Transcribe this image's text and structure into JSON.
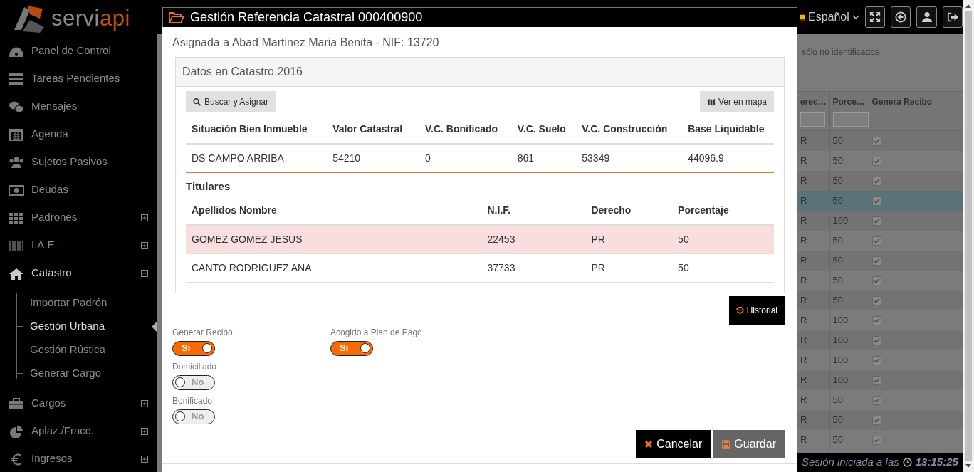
{
  "sidebar": {
    "logo": {
      "prefix": "servi",
      "suffix": "api"
    },
    "items": [
      {
        "label": "Panel de Control"
      },
      {
        "label": "Tareas Pendientes"
      },
      {
        "label": "Mensajes"
      },
      {
        "label": "Agenda"
      },
      {
        "label": "Sujetos Pasivos"
      },
      {
        "label": "Deudas"
      },
      {
        "label": "Padrones",
        "expanded": false
      },
      {
        "label": "I.A.E.",
        "expanded": false
      },
      {
        "label": "Catastro",
        "expanded": true,
        "children": [
          {
            "label": "Importar Padrón",
            "selected": false
          },
          {
            "label": "Gestión Urbana",
            "selected": true
          },
          {
            "label": "Gestión Rústica",
            "selected": false
          },
          {
            "label": "Generar Cargo",
            "selected": false
          }
        ]
      },
      {
        "label": "Cargos",
        "expanded": false
      },
      {
        "label": "Aplaz./Fracc.",
        "expanded": false
      },
      {
        "label": "Ingresos",
        "expanded": false
      }
    ]
  },
  "topbar": {
    "language": "Español"
  },
  "background": {
    "filter_label": "sólo no identificados",
    "table": {
      "columns": [
        "erec…",
        "Porce…",
        "Genera Recibo"
      ],
      "rows": [
        {
          "cells": [
            "R",
            "50"
          ],
          "checked": true,
          "selected": false
        },
        {
          "cells": [
            "R",
            "50"
          ],
          "checked": true,
          "selected": false
        },
        {
          "cells": [
            "R",
            "50"
          ],
          "checked": true,
          "selected": false
        },
        {
          "cells": [
            "R",
            "50"
          ],
          "checked": true,
          "selected": true
        },
        {
          "cells": [
            "R",
            "100"
          ],
          "checked": true,
          "selected": false
        },
        {
          "cells": [
            "R",
            "50"
          ],
          "checked": true,
          "selected": false
        },
        {
          "cells": [
            "R",
            "50"
          ],
          "checked": true,
          "selected": false
        },
        {
          "cells": [
            "R",
            "50"
          ],
          "checked": true,
          "selected": false
        },
        {
          "cells": [
            "R",
            "50"
          ],
          "checked": true,
          "selected": false
        },
        {
          "cells": [
            "R",
            "100"
          ],
          "checked": true,
          "selected": false
        },
        {
          "cells": [
            "R",
            "100"
          ],
          "checked": true,
          "selected": false
        },
        {
          "cells": [
            "R",
            "100"
          ],
          "checked": true,
          "selected": false
        },
        {
          "cells": [
            "R",
            "100"
          ],
          "checked": true,
          "selected": false
        },
        {
          "cells": [
            "R",
            "50"
          ],
          "checked": true,
          "selected": false
        },
        {
          "cells": [
            "R",
            "50"
          ],
          "checked": true,
          "selected": false
        },
        {
          "cells": [
            "R",
            "50"
          ],
          "checked": true,
          "selected": false
        }
      ]
    }
  },
  "status_bar": {
    "session_label": "Sesión iniciada a las",
    "time": "13:15:25"
  },
  "modal": {
    "title": "Gestión Referencia Catastral 000400900",
    "subtitle": "Asignada a Abad Martinez Maria Benita - NIF: 13720",
    "panel": {
      "title": "Datos en Catastro 2016",
      "buttons": [
        {
          "label": "Buscar y Asignar",
          "kind": "search"
        },
        {
          "label": "Ver en mapa",
          "kind": "map"
        }
      ],
      "property_table": {
        "columns": [
          "Situación Bien Inmueble",
          "Valor Catastral",
          "V.C. Bonificado",
          "V.C. Suelo",
          "V.C. Construcción",
          "Base Liquidable"
        ],
        "rows": [
          [
            "DS CAMPO ARRIBA",
            "54210",
            "0",
            "861",
            "53349",
            "44096.9"
          ]
        ]
      },
      "owners_title": "Titulares",
      "owners_table": {
        "columns": [
          "Apellidos Nombre",
          "N.I.F.",
          "Derecho",
          "Porcentaje"
        ],
        "rows": [
          {
            "cells": [
              "GOMEZ GOMEZ JESUS",
              "22453",
              "PR",
              "50"
            ],
            "selected": true
          },
          {
            "cells": [
              "CANTO RODRIGUEZ ANA",
              "37733",
              "PR",
              "50"
            ],
            "selected": false
          }
        ]
      }
    },
    "history_button": "Historial",
    "switches": [
      {
        "label": "Generar Recibo",
        "on": true,
        "text": "Sí"
      },
      {
        "label": "Acogido a Plan de Pago",
        "on": true,
        "text": "Sí"
      },
      {
        "label": "Domiciliado",
        "on": false,
        "text": "No"
      },
      {
        "label": "Bonificado",
        "on": false,
        "text": "No"
      }
    ],
    "buttons": [
      {
        "label": "Cancelar",
        "kind": "cancel"
      },
      {
        "label": "Guardar",
        "kind": "save"
      }
    ]
  }
}
